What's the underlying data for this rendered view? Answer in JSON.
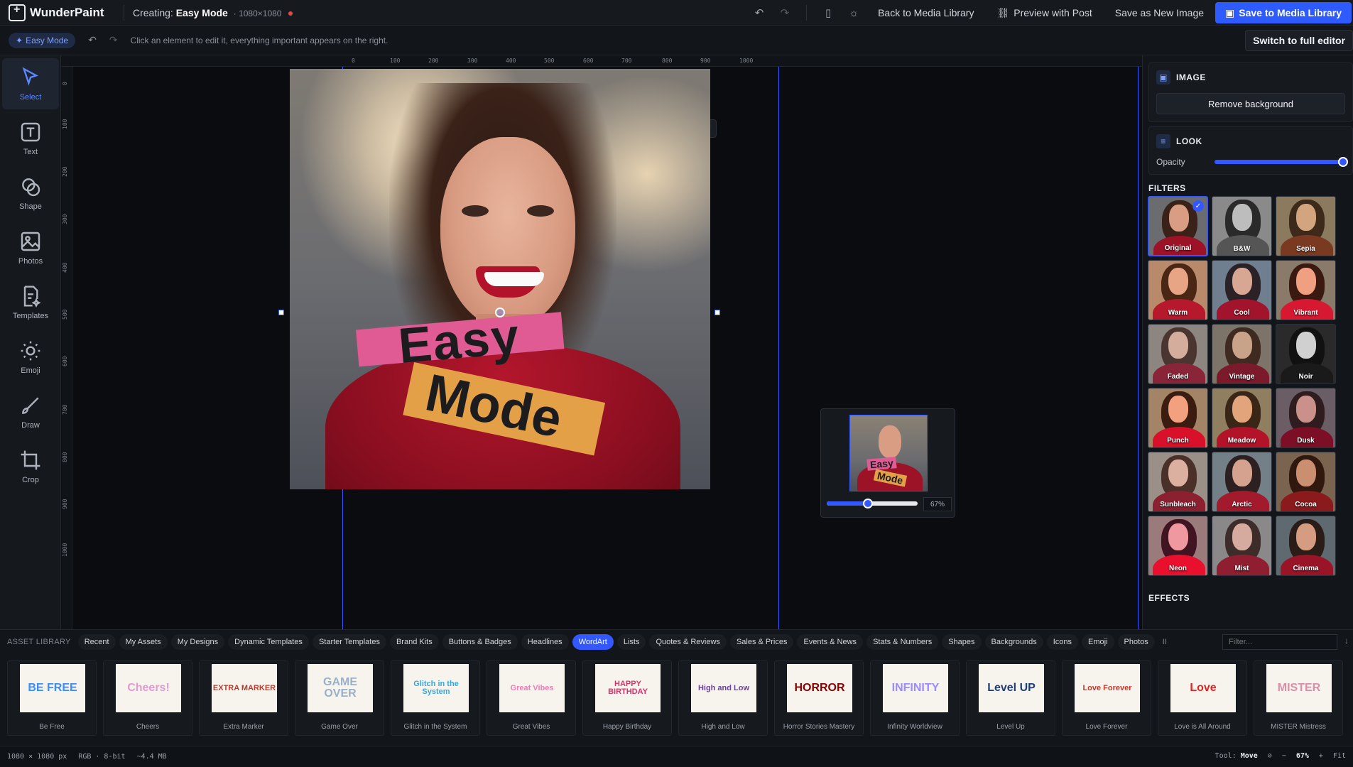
{
  "app": {
    "name": "WunderPaint",
    "creating_prefix": "Creating:",
    "doc_name": "Easy Mode",
    "doc_dims": "· 1080×1080"
  },
  "topbar": {
    "back_label": "Back to Media Library",
    "preview_label": "Preview with Post",
    "save_new_label": "Save as New Image",
    "save_media_label": "Save to Media Library"
  },
  "subbar": {
    "mode_label": "Easy Mode",
    "hint": "Click an element to edit it, everything important appears on the right.",
    "switch_label": "Switch to full editor"
  },
  "tools": [
    {
      "label": "Select",
      "icon": "cursor-icon"
    },
    {
      "label": "Text",
      "icon": "text-icon"
    },
    {
      "label": "Shape",
      "icon": "shape-icon"
    },
    {
      "label": "Photos",
      "icon": "image-icon"
    },
    {
      "label": "Templates",
      "icon": "template-icon"
    },
    {
      "label": "Emoji",
      "icon": "sun-icon"
    },
    {
      "label": "Draw",
      "icon": "brush-icon"
    },
    {
      "label": "Crop",
      "icon": "crop-icon"
    }
  ],
  "ruler": {
    "top": [
      "0",
      "100",
      "200",
      "300",
      "400",
      "500",
      "600",
      "700",
      "800",
      "900",
      "1000"
    ],
    "left": [
      "0",
      "100",
      "200",
      "300",
      "400",
      "500",
      "600",
      "700",
      "800",
      "900",
      "1000"
    ]
  },
  "canvas": {
    "word1": "Easy",
    "word2": "Mode",
    "zoom": "67%",
    "zoom_fraction": 0.45
  },
  "right": {
    "image_title": "IMAGE",
    "remove_bg": "Remove background",
    "look_title": "LOOK",
    "opacity_label": "Opacity",
    "opacity_value": 1.0,
    "filters_title": "FILTERS",
    "effects_title": "EFFECTS",
    "filters": [
      {
        "name": "Original",
        "selected": true,
        "tone": "orig"
      },
      {
        "name": "B&W",
        "tone": "bw"
      },
      {
        "name": "Sepia",
        "tone": "sepia"
      },
      {
        "name": "Warm",
        "tone": "warm"
      },
      {
        "name": "Cool",
        "tone": "cool"
      },
      {
        "name": "Vibrant",
        "tone": "vibrant"
      },
      {
        "name": "Faded",
        "tone": "faded"
      },
      {
        "name": "Vintage",
        "tone": "vintage"
      },
      {
        "name": "Noir",
        "tone": "noir"
      },
      {
        "name": "Punch",
        "tone": "punch"
      },
      {
        "name": "Meadow",
        "tone": "meadow"
      },
      {
        "name": "Dusk",
        "tone": "dusk"
      },
      {
        "name": "Sunbleach",
        "tone": "sunbleach"
      },
      {
        "name": "Arctic",
        "tone": "arctic"
      },
      {
        "name": "Cocoa",
        "tone": "cocoa"
      },
      {
        "name": "Neon",
        "tone": "neon"
      },
      {
        "name": "Mist",
        "tone": "mist"
      },
      {
        "name": "Cinema",
        "tone": "cinema"
      }
    ]
  },
  "assets": {
    "label": "ASSET LIBRARY",
    "tabs": [
      "Recent",
      "My Assets",
      "My Designs",
      "Dynamic Templates",
      "Starter Templates",
      "Brand Kits",
      "Buttons & Badges",
      "Headlines",
      "WordArt",
      "Lists",
      "Quotes & Reviews",
      "Sales & Prices",
      "Events & News",
      "Stats & Numbers",
      "Shapes",
      "Backgrounds",
      "Icons",
      "Emoji",
      "Photos"
    ],
    "active_tab": "WordArt",
    "filter_placeholder": "Filter...",
    "items": [
      {
        "name": "Be Free",
        "art": "BE FREE",
        "color": "#3b8cff"
      },
      {
        "name": "Cheers",
        "art": "Cheers!",
        "color": "#e39ad0"
      },
      {
        "name": "Extra Marker",
        "art": "EXTRA MARKER",
        "color": "#c0392b"
      },
      {
        "name": "Game Over",
        "art": "GAME OVER",
        "color": "#9ab0c8"
      },
      {
        "name": "Glitch in the System",
        "art": "Glitch in the System",
        "color": "#3aa7d8"
      },
      {
        "name": "Great Vibes",
        "art": "Great Vibes",
        "color": "#f07bb5"
      },
      {
        "name": "Happy Birthday",
        "art": "HAPPY BIRTHDAY",
        "color": "#d6336c"
      },
      {
        "name": "High and Low",
        "art": "High and Low",
        "color": "#6b3fa0"
      },
      {
        "name": "Horror Stories Mastery",
        "art": "HORROR",
        "color": "#8b0000"
      },
      {
        "name": "Infinity Worldview",
        "art": "INFINITY",
        "color": "#9b8cff"
      },
      {
        "name": "Level Up",
        "art": "Level UP",
        "color": "#1f3d7a"
      },
      {
        "name": "Love Forever",
        "art": "Love Forever",
        "color": "#c0392b"
      },
      {
        "name": "Love is All Around",
        "art": "Love",
        "color": "#e02424"
      },
      {
        "name": "MISTER Mistress",
        "art": "MISTER",
        "color": "#d98fa8"
      }
    ]
  },
  "status": {
    "size": "1080 × 1080 px",
    "color": "RGB · 8-bit",
    "weight": "~4.4 MB",
    "tool_label": "Tool:",
    "tool_value": "Move",
    "zoom": "67%",
    "fit": "Fit"
  }
}
